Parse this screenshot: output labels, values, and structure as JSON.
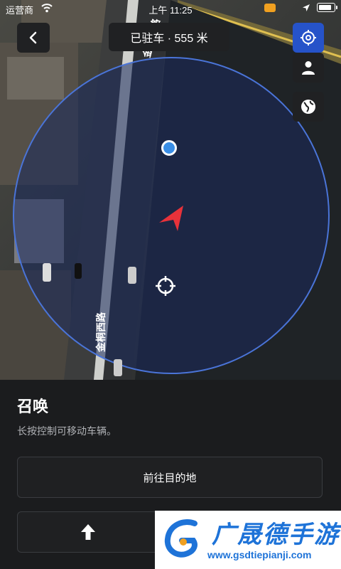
{
  "status_bar": {
    "carrier": "运营商",
    "time": "上午 11:25"
  },
  "header": {
    "back_icon": "chevron-left-icon",
    "title": "已驻车 · 555 米"
  },
  "side_buttons": [
    {
      "icon": "crosshair-icon",
      "active": true
    },
    {
      "icon": "person-icon",
      "active": false
    },
    {
      "icon": "globe-icon",
      "active": false
    }
  ],
  "map": {
    "road_labels": [
      "金桐西路",
      "金桐西路"
    ],
    "markers": [
      "blue-dot-icon",
      "navigation-arrow-icon",
      "target-crosshair-icon"
    ]
  },
  "panel": {
    "title": "召唤",
    "description": "长按控制可移动车辆。",
    "destination_button": "前往目的地",
    "forward_icon": "arrow-up-icon"
  },
  "watermark": {
    "title": "广晟德手游",
    "url": "www.gsdtiepianji.com"
  },
  "colors": {
    "accent": "#2653c9",
    "marker": "#e8323a",
    "dot": "#3a8ee6",
    "circle": "#4a74d8"
  }
}
